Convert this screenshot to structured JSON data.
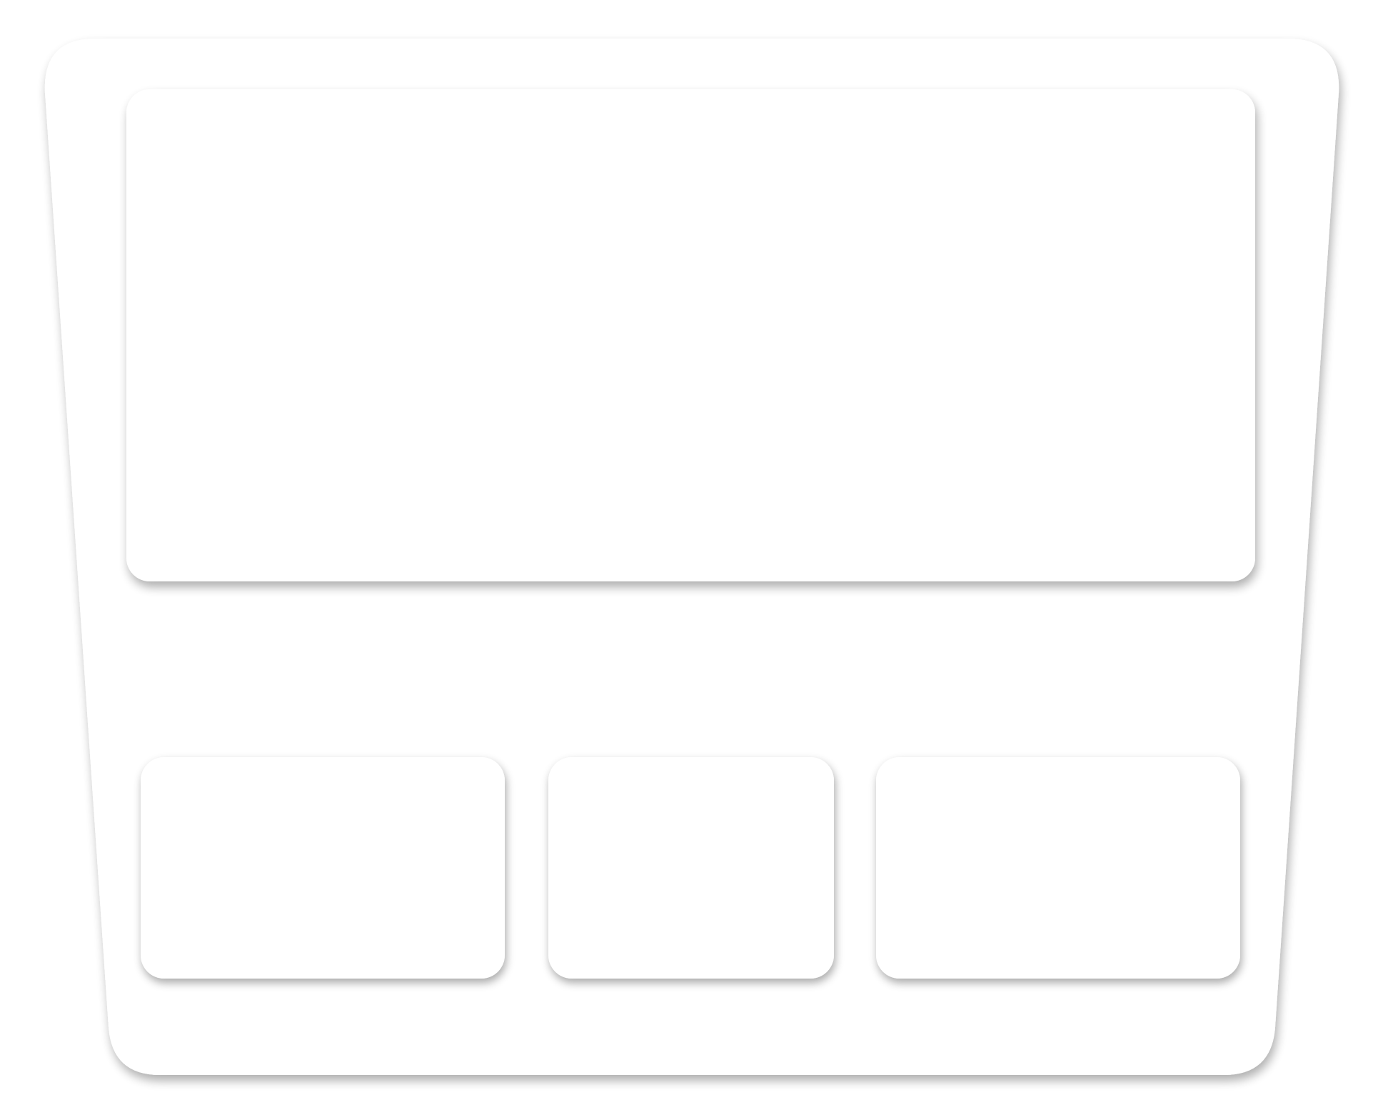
{
  "colors": {
    "background": "#ffffff",
    "panel_fill": "#ffffff",
    "shadow": "#000000"
  },
  "console": {
    "slots": [
      {
        "role": "main-display-slot"
      },
      {
        "role": "left-module-slot"
      },
      {
        "role": "center-module-slot"
      },
      {
        "role": "right-module-slot"
      }
    ]
  }
}
